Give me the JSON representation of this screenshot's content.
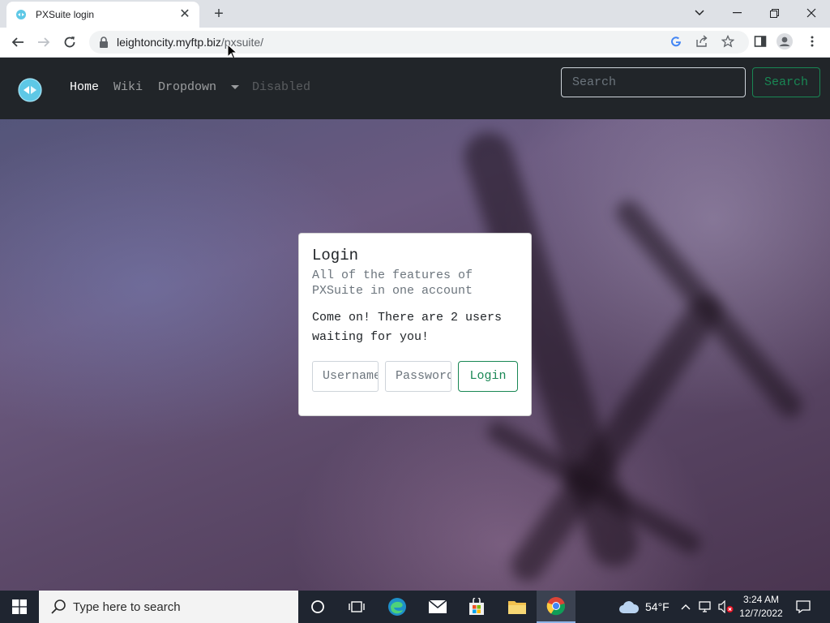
{
  "browser": {
    "tab_title": "PXSuite login",
    "tab_close": "✕",
    "new_tab": "+",
    "url_host": "leightoncity.myftp.biz",
    "url_path": "/pxsuite/"
  },
  "navbar": {
    "links": [
      "Home",
      "Wiki",
      "Dropdown",
      "Disabled"
    ],
    "search_placeholder": "Search",
    "search_button": "Search"
  },
  "login_card": {
    "title": "Login",
    "subtitle": "All of the features of PXSuite in one account",
    "text": "Come on! There are 2 users waiting for you!",
    "username_placeholder": "Username",
    "password_placeholder": "Password",
    "login_button": "Login"
  },
  "taskbar": {
    "search_placeholder": "Type here to search",
    "weather": "54°F",
    "time": "3:24 AM",
    "date": "12/7/2022"
  },
  "colors": {
    "navbar_bg": "#212529",
    "success": "#198754"
  }
}
